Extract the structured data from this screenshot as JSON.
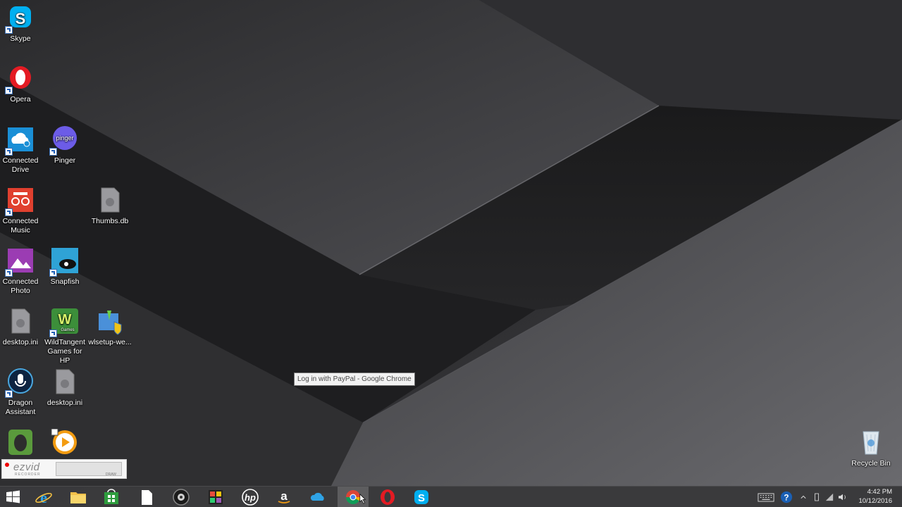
{
  "desktop": {
    "icons": {
      "skype": "Skype",
      "opera": "Opera",
      "connected_drive": "Connected Drive",
      "pinger": "Pinger",
      "pinger_badge": "pinger",
      "connected_music": "Connected Music",
      "thumbs_db": "Thumbs.db",
      "connected_photo": "Connected Photo",
      "snapfish": "Snapfish",
      "desktop_ini_1": "desktop.ini",
      "wildtangent": "WildTangent Games for HP",
      "wildtangent_badge": "Games",
      "wlsetup": "wlsetup-we...",
      "dragon": "Dragon Assistant",
      "desktop_ini_2": "desktop.ini",
      "recycle_bin": "Recycle Bin"
    },
    "tooltip": "Log in with PayPal - Google Chrome",
    "ezvid": {
      "logo": "ezvid",
      "sub": "RECORDER",
      "draw": "DRAW"
    }
  },
  "taskbar": {
    "items": [
      "start-icon",
      "internet-explorer-icon",
      "file-explorer-icon",
      "store-icon",
      "blank-document-icon",
      "webcam-icon",
      "photo-gallery-icon",
      "hp-icon",
      "amazon-icon",
      "connected-drive-icon",
      "chrome-icon",
      "opera-icon",
      "skype-icon"
    ],
    "active": "chrome-icon"
  },
  "tray": {
    "time": "4:42 PM",
    "date": "10/12/2016"
  },
  "colors": {
    "skype": "#00aff0",
    "opera": "#e41b23",
    "hp_blue": "#1a8fd6",
    "music_red": "#e0402f",
    "photo_purple": "#9b3cb3",
    "pinger_purple": "#6c5ce7",
    "evernote_green": "#5a9a3c"
  }
}
